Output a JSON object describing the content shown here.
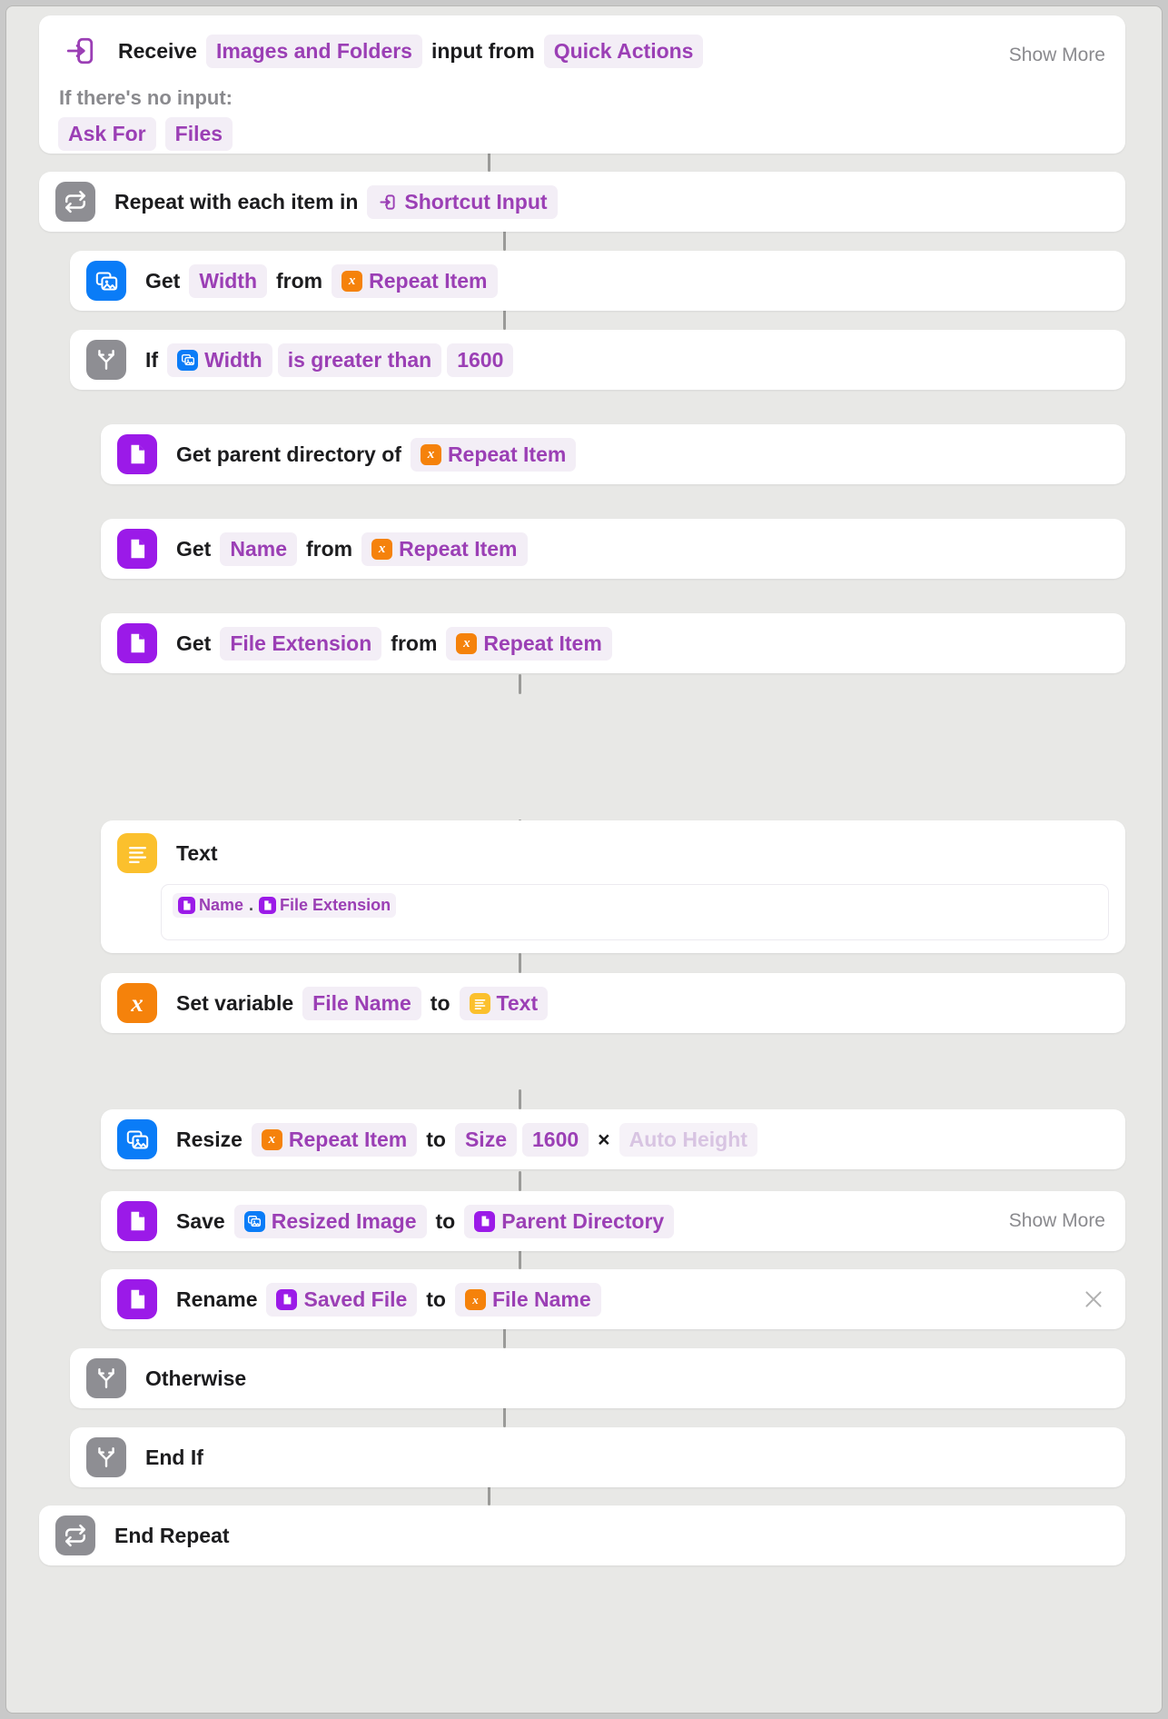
{
  "app": {
    "title": "Shortcuts Editor",
    "background_color": "#e8e8e6",
    "card_color": "#ffffff",
    "accent_purple": "#9b3fb5",
    "accent_blue": "#0a7cf7",
    "accent_orange": "#f5820b",
    "accent_yellow": "#fbc02d",
    "accent_gray": "#8e8e93"
  },
  "receive": {
    "icon": "input-arrow-icon",
    "label": "Receive",
    "input_type": "Images and Folders",
    "middle": "input from",
    "source": "Quick Actions",
    "show_more": "Show More",
    "no_input_label": "If there's no input:",
    "ask_for": "Ask For",
    "ask_for_value": "Files"
  },
  "actions": [
    {
      "id": "repeat-start",
      "icon": "repeat-icon",
      "icon_color": "gray",
      "label": "Repeat with each item in",
      "token": "Shortcut Input",
      "token_icon": "input-arrow-icon"
    },
    {
      "id": "get-width",
      "icon": "image-stack-icon",
      "icon_color": "blue",
      "label": "Get",
      "property": "Width",
      "middle": "from",
      "token": "Repeat Item",
      "token_icon": "variable-x-icon"
    },
    {
      "id": "if-condition",
      "icon": "branch-icon",
      "icon_color": "gray",
      "label": "If",
      "subject": "Width",
      "subject_icon": "image-stack-icon",
      "operator": "is greater than",
      "value": "1600"
    },
    {
      "id": "get-parent-directory",
      "icon": "document-icon",
      "icon_color": "purple",
      "label": "Get parent directory of",
      "token": "Repeat Item",
      "token_icon": "variable-x-icon"
    },
    {
      "id": "get-name",
      "icon": "document-icon",
      "icon_color": "purple",
      "label": "Get",
      "property": "Name",
      "middle": "from",
      "token": "Repeat Item",
      "token_icon": "variable-x-icon"
    },
    {
      "id": "get-file-extension",
      "icon": "document-icon",
      "icon_color": "purple",
      "label": "Get",
      "property": "File Extension",
      "middle": "from",
      "token": "Repeat Item",
      "token_icon": "variable-x-icon"
    },
    {
      "id": "text-action",
      "icon": "text-lines-icon",
      "icon_color": "yellow",
      "label": "Text",
      "field_tokens": [
        {
          "text": "Name",
          "icon": "document-icon"
        },
        {
          "text": "File Extension",
          "icon": "document-icon"
        }
      ],
      "separator": "."
    },
    {
      "id": "set-variable",
      "icon": "variable-x-icon",
      "icon_color": "orange",
      "label": "Set variable",
      "variable": "File Name",
      "middle": "to",
      "token": "Text",
      "token_icon": "text-lines-icon"
    },
    {
      "id": "resize-image",
      "icon": "image-stack-icon",
      "icon_color": "blue",
      "label": "Resize",
      "token": "Repeat Item",
      "token_icon": "variable-x-icon",
      "middle": "to",
      "mode": "Size",
      "width_value": "1600",
      "times": "×",
      "height_placeholder": "Auto Height"
    },
    {
      "id": "save-file",
      "icon": "document-icon",
      "icon_color": "purple",
      "label": "Save",
      "token": "Resized Image",
      "token_icon": "image-stack-icon",
      "middle": "to",
      "destination": "Parent Directory",
      "destination_icon": "document-icon",
      "show_more": "Show More"
    },
    {
      "id": "rename-file",
      "icon": "document-icon",
      "icon_color": "purple",
      "label": "Rename",
      "token": "Saved File",
      "token_icon": "document-icon",
      "middle": "to",
      "destination": "File Name",
      "destination_icon": "variable-x-icon",
      "close_icon": "close-icon"
    },
    {
      "id": "otherwise",
      "icon": "branch-icon",
      "icon_color": "gray",
      "label": "Otherwise"
    },
    {
      "id": "end-if",
      "icon": "branch-icon",
      "icon_color": "gray",
      "label": "End If"
    },
    {
      "id": "end-repeat",
      "icon": "repeat-icon",
      "icon_color": "gray",
      "label": "End Repeat"
    }
  ]
}
